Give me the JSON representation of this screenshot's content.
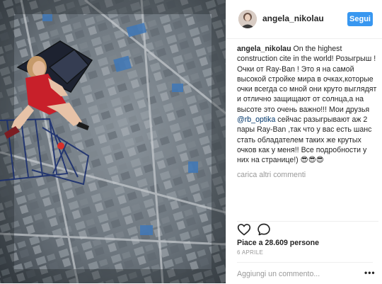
{
  "post": {
    "username": "angela_nikolau",
    "follow_label": "Segui"
  },
  "caption": {
    "username": "angela_nikolau",
    "text_1": " On the highest construction cite in the world! Розыгрыш ! Очки от Ray-Ban ! Это я на самой высокой стройке мира в очках,которые очки всегда со мной они круто выглядят и отлично защищают от солнца,а на высоте это очень важно!!! Мои друзья ",
    "mention": "@rb_optika",
    "text_2": " сейчас разыгрывают аж 2 пары Ray-Ban ,так что у вас есть шанс стать обладателем таких же крутых очков как у меня!! Все подробности у них на странице!) 😎😎😎"
  },
  "more_comments_label": "carica altri commenti",
  "likes_text": "Piace a 28.609 persone",
  "date_text": "6 APRILE",
  "comment_input": {
    "placeholder": "Aggiungi un commento..."
  },
  "more_label": "•••",
  "colors": {
    "follow_button": "#3897f0",
    "mention": "#003569",
    "muted": "#999999"
  },
  "icons": [
    "heart-icon",
    "comment-icon",
    "more-options-icon"
  ]
}
